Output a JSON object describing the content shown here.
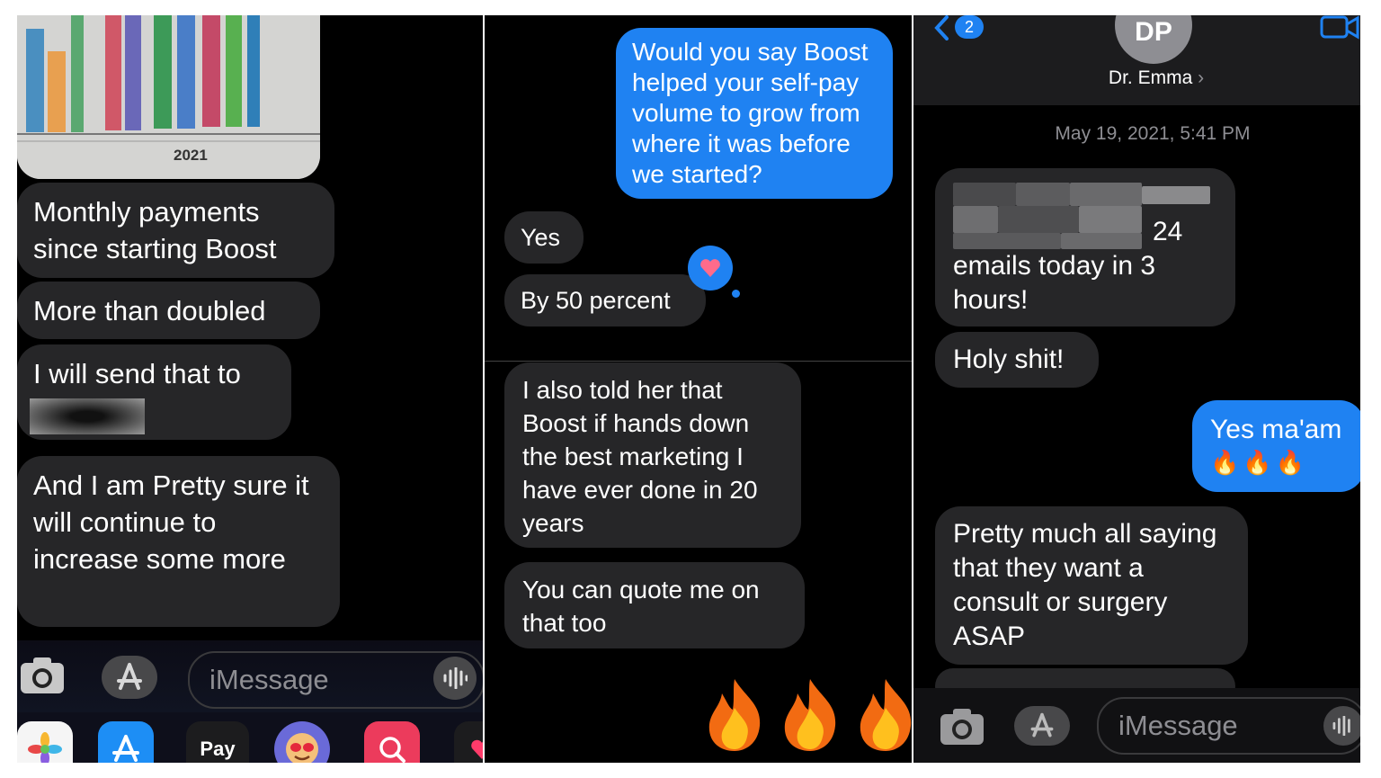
{
  "panel1": {
    "chart_year": "2021",
    "bubbles": [
      "Monthly payments since starting Boost",
      "More than doubled",
      "I will send that to",
      "And I am Pretty sure it will continue to increase some more"
    ],
    "input_placeholder": "iMessage",
    "dock": [
      "Photos",
      "App Store",
      "Pay",
      "Memoji",
      "Search",
      "Heart"
    ],
    "pay_label": "Pay"
  },
  "panel2": {
    "outgoing": "Would you say Boost helped your self-pay volume to grow from where it was before we started?",
    "incoming": [
      "Yes",
      "By 50 percent"
    ],
    "incoming2": [
      "I also told her that Boost if hands down the best marketing I have ever done in 20 years",
      "You can quote me on that too"
    ],
    "reaction": "heart",
    "emoji_row": "🔥🔥🔥"
  },
  "panel3": {
    "back_count": "2",
    "avatar_initials": "DP",
    "contact_name": "Dr. Emma",
    "timestamp": "May 19, 2021, 5:41 PM",
    "incoming1_tail": "24",
    "incoming1_rest": "emails today in 3 hours!",
    "incoming2": "Holy shit!",
    "outgoing": "Yes ma'am",
    "outgoing_emoji": "🔥🔥🔥",
    "incoming3": "Pretty much all saying that they want a consult or surgery ASAP",
    "input_placeholder": "iMessage"
  },
  "colors": {
    "imessage_blue": "#1f82f2",
    "incoming_grey": "#262628",
    "background": "#000000"
  }
}
